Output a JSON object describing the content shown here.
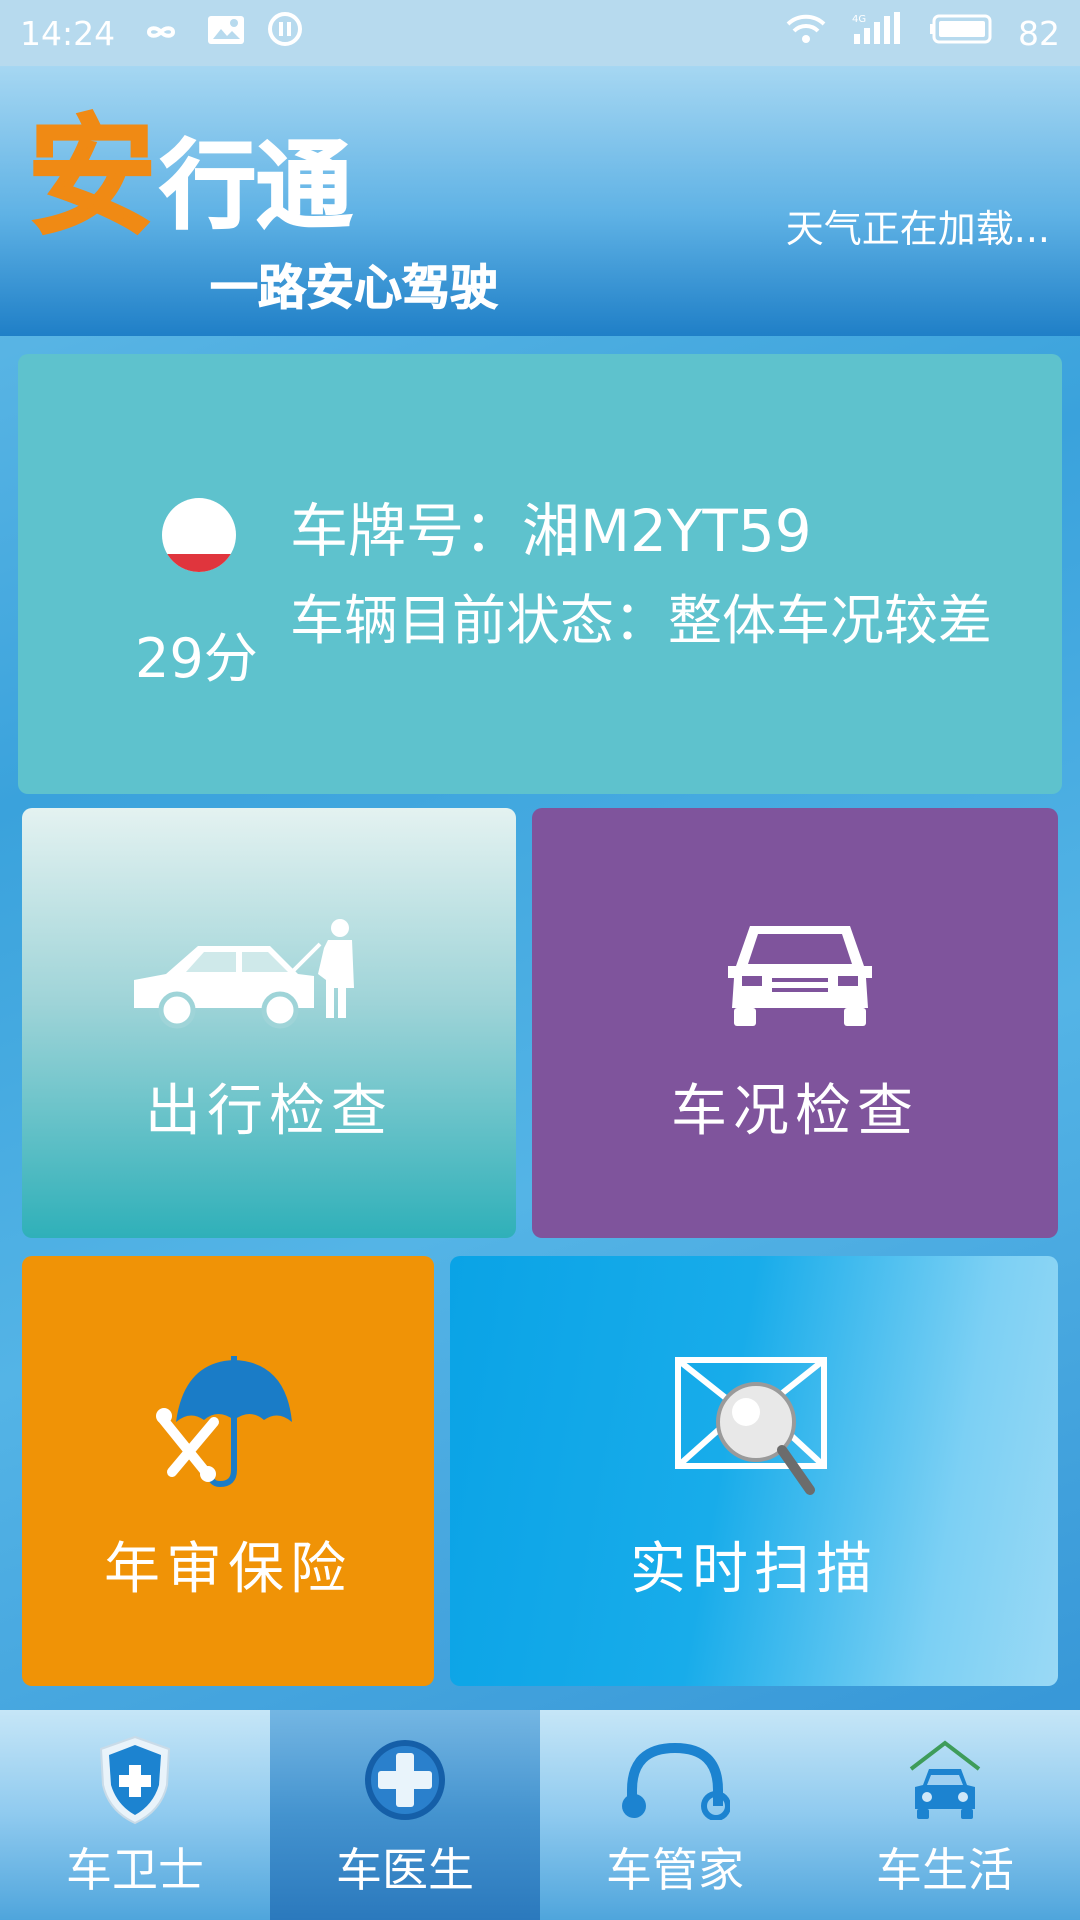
{
  "status_bar": {
    "time": "14:24",
    "battery": "82",
    "network": "4G"
  },
  "header": {
    "logo_accent": "安",
    "logo_rest": "行通",
    "slogan": "一路安心驾驶",
    "weather": "天气正在加载..."
  },
  "vehicle": {
    "score": "29分",
    "score_fill_fraction": 0.24,
    "plate_label": "车牌号：",
    "plate_number": "湘M2YT59",
    "status_label": "车辆目前状态：",
    "status_value": "整体车况较差"
  },
  "tiles": {
    "trip_check": "出行检查",
    "condition_check": "车况检查",
    "inspection_insurance": "年审保险",
    "realtime_scan": "实时扫描"
  },
  "nav": {
    "items": [
      {
        "label": "车卫士",
        "icon": "shield-icon"
      },
      {
        "label": "车医生",
        "icon": "medical-cross-icon",
        "active": true
      },
      {
        "label": "车管家",
        "icon": "headphones-icon"
      },
      {
        "label": "车生活",
        "icon": "car-home-icon"
      }
    ]
  },
  "colors": {
    "accent_orange": "#f08a14",
    "card_teal": "#5ec2cd",
    "tile_purple": "#7f549c",
    "tile_orange": "#f09306",
    "score_red": "#e0353d"
  }
}
